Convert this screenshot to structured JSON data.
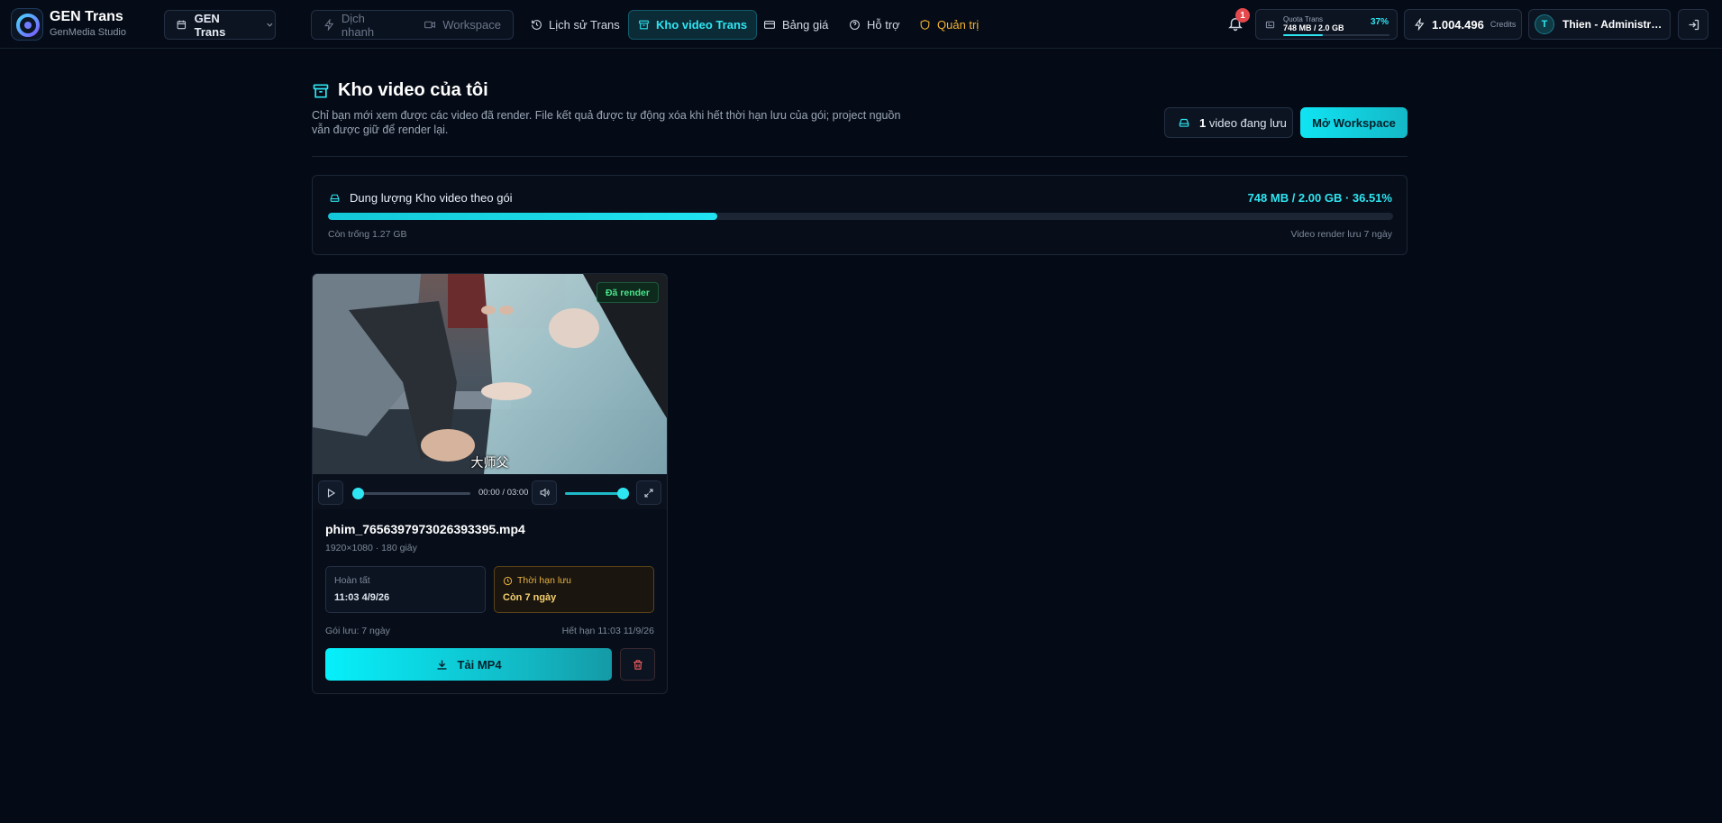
{
  "topbar": {
    "brand_title": "GEN Trans",
    "brand_subtitle": "GenMedia Studio",
    "workspace_select": "GEN Trans",
    "segment": {
      "quick": "Dịch nhanh",
      "workspace": "Workspace"
    },
    "nav": {
      "history": "Lịch sử Trans",
      "video": "Kho video Trans",
      "pricing": "Bảng giá",
      "support": "Hỗ trợ",
      "admin": "Quản trị"
    },
    "notifications_count": "1",
    "quota": {
      "label": "Quota Trans",
      "value": "748 MB / 2.0 GB",
      "percent_text": "37%",
      "fill": 0.37
    },
    "credits": {
      "value": "1.004.496",
      "label": "Credits"
    },
    "user": {
      "initial": "T",
      "name": "Thien - Administrator"
    }
  },
  "header": {
    "title": "Kho video của tôi",
    "description": "Chỉ bạn mới xem được các video đã render. File kết quả được tự động xóa khi hết thời hạn lưu của gói; project nguồn vẫn được giữ để render lại.",
    "count_number": "1",
    "count_text": "video đang lưu",
    "open_workspace": "Mở Workspace"
  },
  "storage": {
    "title": "Dung lượng Kho video theo gói",
    "usage": "748 MB / 2.00 GB · 36.51%",
    "fill_percent": 36.51,
    "free": "Còn trống 1.27 GB",
    "retention": "Video render lưu 7 ngày"
  },
  "video": {
    "badge": "Đã render",
    "subtitle": "大师父",
    "time": "00:00 / 03:00",
    "position_fraction": 0,
    "volume_fraction": 1,
    "filename": "phim_7656397973026393395.mp4",
    "meta": "1920×1080 · 180 giây",
    "done_label": "Hoàn tất",
    "done_value": "11:03 4/9/26",
    "expire_label": "Thời hạn lưu",
    "expire_value": "Còn 7 ngày",
    "plan": "Gói lưu: 7 ngày",
    "expire_date": "Hết hạn 11:03 11/9/26",
    "download": "Tải MP4"
  },
  "colors": {
    "background": "#050b16",
    "accent": "#2ee6f2",
    "admin": "#f5b431",
    "success": "#4be38a",
    "danger": "#ef5b5b"
  },
  "icons": {
    "workspace_select": "calendar-icon",
    "quick": "lightning-icon",
    "workspace": "video-camera-icon",
    "history": "history-icon",
    "video": "archive-icon",
    "pricing": "credit-card-icon",
    "support": "help-circle-icon",
    "admin": "shield-icon",
    "bell": "bell-icon",
    "logout": "logout-icon",
    "storage": "hard-drive-icon",
    "download": "download-icon",
    "delete": "trash-icon"
  }
}
